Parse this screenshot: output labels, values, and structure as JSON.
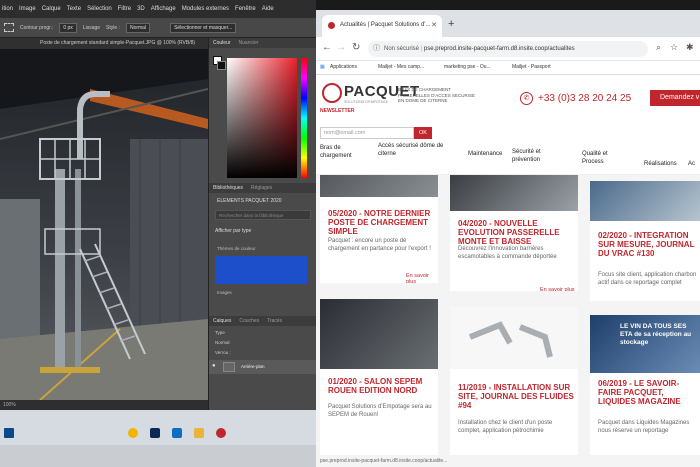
{
  "photoshop": {
    "menu": [
      "ition",
      "Image",
      "Calque",
      "Texte",
      "Sélection",
      "Filtre",
      "3D",
      "Affichage",
      "Modules externes",
      "Fenêtre",
      "Aide"
    ],
    "options": {
      "contour_progressif": "Contour progr.:",
      "contour_value": "0 px",
      "lissage": "Lissage",
      "style_label": "Style :",
      "style_value": "Normal",
      "select_mask": "Sélectionner et masquer..."
    },
    "doc_tab": "Poste de chargement standard simple-Pacquet.JPG @ 100% (RVB/8)",
    "status": "100%",
    "color_tabs": [
      "Couleur",
      "Nuancier"
    ],
    "library_tabs": [
      "Bibliothèques",
      "Réglages"
    ],
    "library_name": "ELEMENTS PACQUET 2020",
    "library_search": "Rechercher dans la bibliothèque",
    "sort_label": "Afficher par type",
    "section_colors": "Thèmes de couleur",
    "section_images": "Images",
    "layers_tabs": [
      "Calques",
      "Couches",
      "Tracés"
    ],
    "layer_kind": "Type",
    "layer_mode": "Normal",
    "layer_lock": "Verrou :",
    "layer_name": "Arrière-plan",
    "swatch_color": "#1c4fc9"
  },
  "chrome": {
    "tab_title": "Actualités | Pacquet Solutions d'...",
    "new_tab": "+",
    "security": "Non sécurisé",
    "url": "pse.preprod.insite-pacquet-farm.d8.insite.coop/actualites",
    "bookmarks": [
      "Applications",
      "Mailjet - Mes camp...",
      "marketing pse - Ou...",
      "Mailjet - Passport"
    ],
    "bottom_url": "pse.preprod.insite-pacquet-farm.d8.insite.coop/actualite..."
  },
  "site": {
    "brand": "PACQUET",
    "brand_sub": "SOLUTIONS D'EMPOTAGE",
    "newsletter": "NEWSLETTER",
    "tagline": "BRAS DE CHARGEMENT PASSERELLES D'ACCES SECURISE EN DOME DE CITERNE",
    "phone": "+33 (0)3 28 20 24 25",
    "cta": "Demandez v",
    "email_placeholder": "nom@email.com",
    "ok": "OK",
    "nav": [
      "Bras de chargement",
      "Accès sécurisé dôme de citerne",
      "Maintenance",
      "Sécurité et prévention",
      "Qualité et Process",
      "Réalisations",
      "Ac"
    ],
    "more_label": "En savoir plus",
    "articles": [
      {
        "title": "05/2020 - NOTRE DERNIER POSTE DE CHARGEMENT SIMPLE",
        "text": "Pacquet : encore un poste de chargement en partance pour l'export !"
      },
      {
        "title": "04/2020 - NOUVELLE EVOLUTION PASSERELLE MONTE ET BAISSE",
        "text": "Découvrez l'innovation barrières escamotables à commande déportée"
      },
      {
        "title": "02/2020 - INTEGRATION SUR MESURE, JOURNAL DU VRAC #130",
        "text": "Focus site client, application charbon actif dans ce reportage complet"
      },
      {
        "title": "01/2020 - SALON SEPEM ROUEN EDITION NORD",
        "text": "Pacquet Solutions d'Empotage sera au SEPEM de Rouen!"
      },
      {
        "title": "11/2019 - INSTALLATION SUR SITE, JOURNAL DES FLUIDES #94",
        "text": "Installation chez le client d'un poste complet, application pétrochimie"
      },
      {
        "title": "06/2019 - LE SAVOIR-FAIRE PACQUET, LIQUIDES MAGAZINE",
        "text": "Pacquet dans Liquides Magazines nous réserve un reportage"
      }
    ],
    "banner_text": "LE VIN DA TOUS SES ETA de sa réception au stockage",
    "accent_color": "#c0262d"
  }
}
